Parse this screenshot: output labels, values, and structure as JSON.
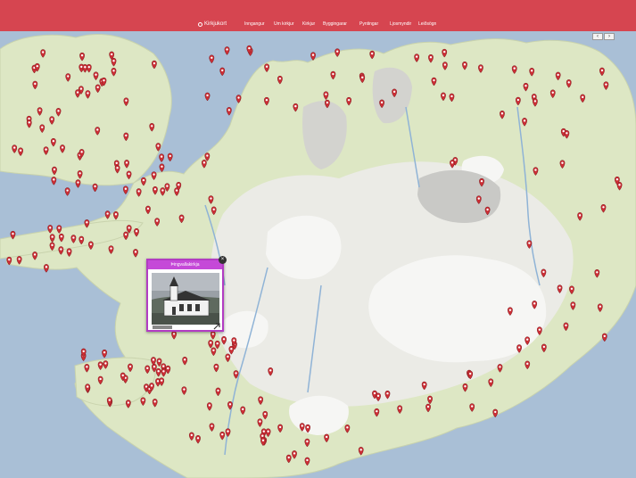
{
  "site": {
    "brand": "Kirkjukort"
  },
  "nav": {
    "items": [
      "Inngangur",
      "Um kirkjur",
      "Kirkjur",
      "Byggingarar",
      "Pyntingar",
      "Ljosmyndir",
      "Leiðsögn"
    ]
  },
  "map_controls": {
    "prev": "‹",
    "next": "›"
  },
  "popup": {
    "title": "Þingvallakirkja",
    "close": "×"
  },
  "colors": {
    "header": "#d64550",
    "sea": "#a9bfd6",
    "land": "#dde7c4",
    "glacier": "#f6f6f4",
    "marker": "#cc2e35",
    "popup_accent": "#c549d8"
  },
  "icons": {
    "marker": "map-pin-icon",
    "close": "close-icon"
  }
}
